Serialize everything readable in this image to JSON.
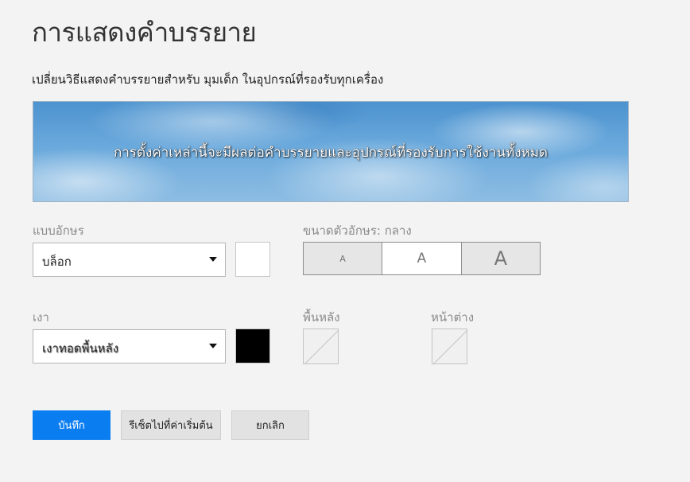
{
  "page": {
    "title": "การแสดงคำบรรยาย",
    "subtitle": "เปลี่ยนวิธีแสดงคำบรรยายสำหรับ มุมเด็ก ในอุปกรณ์ที่รองรับทุกเครื่อง"
  },
  "preview": {
    "text": "การตั้งค่าเหล่านี้จะมีผลต่อคำบรรยายและอุปกรณ์ที่รองรับการใช้งานทั้งหมด"
  },
  "font": {
    "label": "แบบอักษร",
    "selected": "บล็อก",
    "color": "#ffffff"
  },
  "font_size": {
    "label": "ขนาดตัวอักษร: กลาง",
    "options": [
      "A",
      "A",
      "A"
    ],
    "selected_index": 1
  },
  "shadow": {
    "label": "เงา",
    "selected": "เงาทอดพื้นหลัง",
    "color": "#000000"
  },
  "background": {
    "label": "พื้นหลัง",
    "color": "none"
  },
  "window": {
    "label": "หน้าต่าง",
    "color": "none"
  },
  "buttons": {
    "save": "บันทึก",
    "reset": "รีเซ็ตไปที่ค่าเริ่มต้น",
    "cancel": "ยกเลิก"
  },
  "colors": {
    "primary": "#0a7ef0",
    "page_background": "#f3f3f3"
  }
}
